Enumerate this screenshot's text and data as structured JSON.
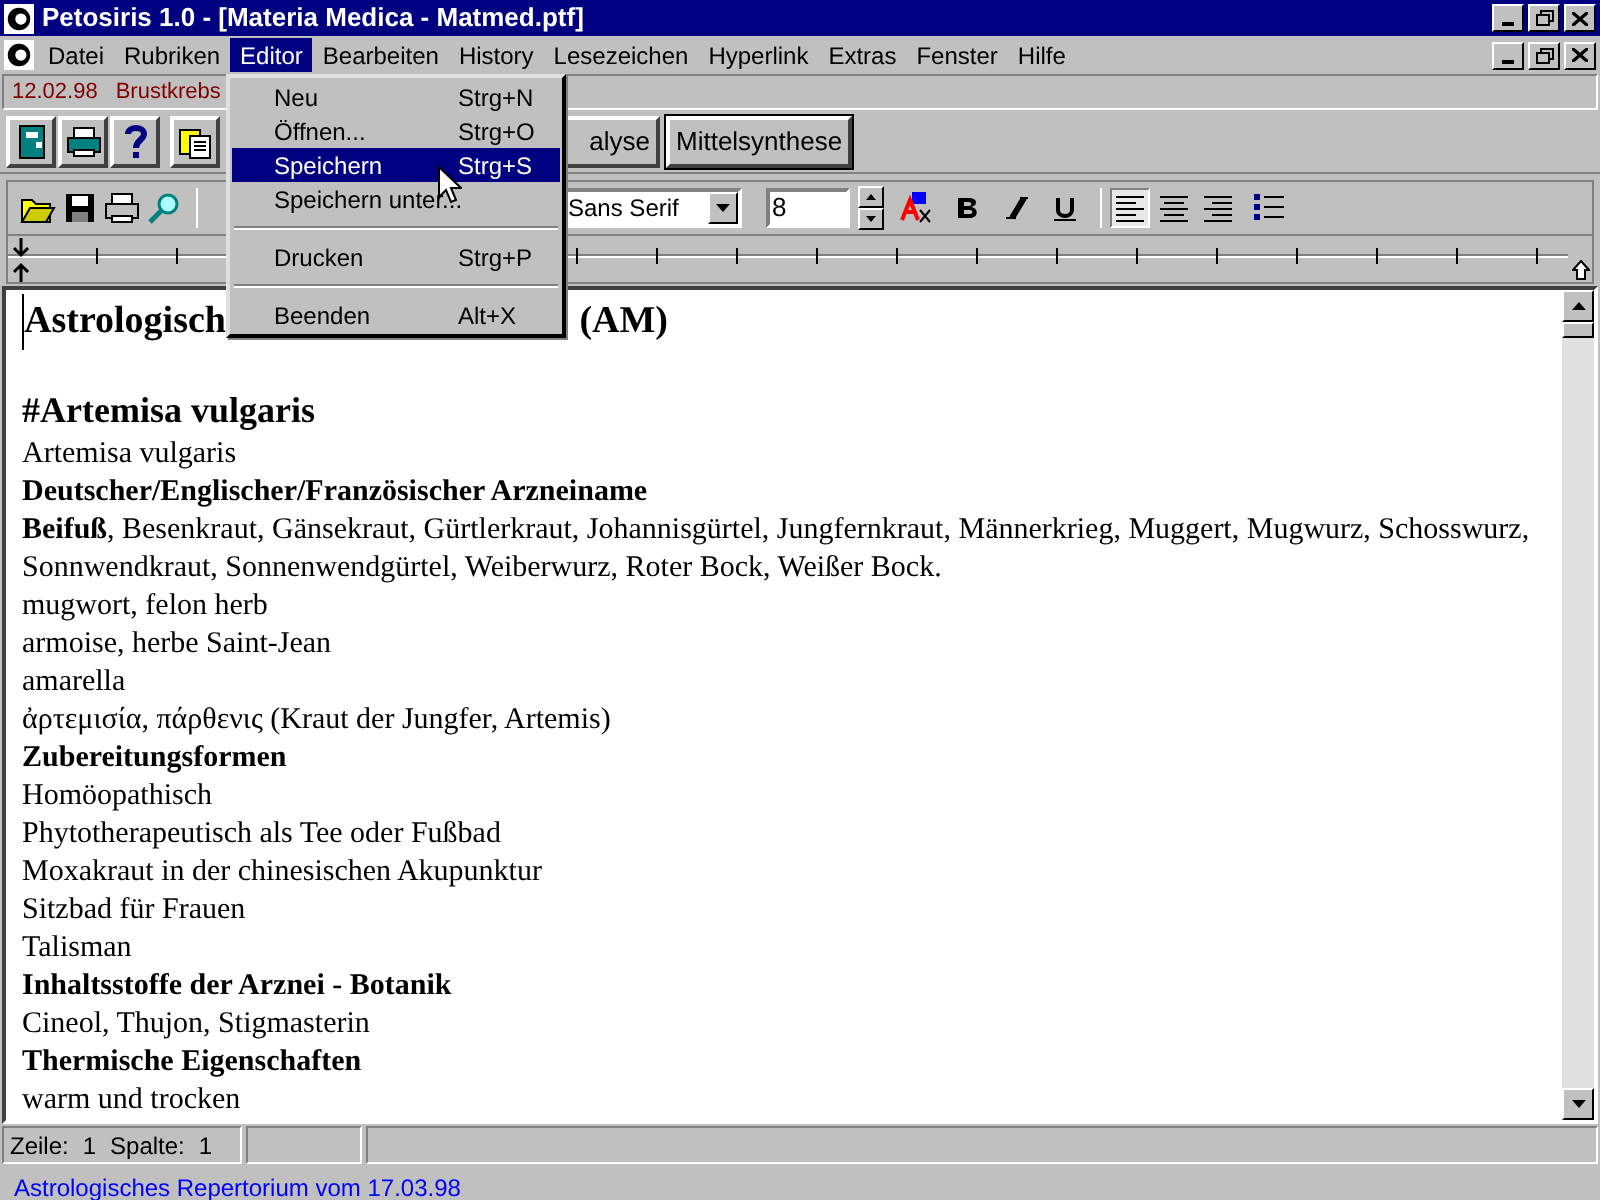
{
  "window": {
    "title": "Petosiris 1.0 - [Materia Medica - Matmed.ptf]"
  },
  "menubar": [
    {
      "label": "Datei",
      "open": false
    },
    {
      "label": "Rubriken",
      "open": false
    },
    {
      "label": "Editor",
      "open": true
    },
    {
      "label": "Bearbeiten",
      "open": false
    },
    {
      "label": "History",
      "open": false
    },
    {
      "label": "Lesezeichen",
      "open": false
    },
    {
      "label": "Hyperlink",
      "open": false
    },
    {
      "label": "Extras",
      "open": false
    },
    {
      "label": "Fenster",
      "open": false
    },
    {
      "label": "Hilfe",
      "open": false
    }
  ],
  "info_bar": {
    "date": "12.02.98",
    "topic": "Brustkrebs"
  },
  "toolbar": {
    "text_buttons": [
      "alyse",
      "Mittelsynthese"
    ]
  },
  "format_bar": {
    "font": "Sans Serif",
    "size": "8",
    "alignment": [
      {
        "kind": "left",
        "selected": true
      },
      {
        "kind": "center",
        "selected": false
      },
      {
        "kind": "right",
        "selected": false
      }
    ]
  },
  "document": {
    "title_start": "Astrologisch",
    "title_end": "(AM)",
    "lines": [
      {
        "kind": "blank"
      },
      {
        "kind": "heading",
        "text": "#Artemisa vulgaris"
      },
      {
        "kind": "normal",
        "text": "Artemisa vulgaris"
      },
      {
        "kind": "bold",
        "text": "Deutscher/Englischer/Französischer Arzneiname"
      },
      {
        "kind": "normal",
        "text": "**Beifuß**, Besenkraut, Gänsekraut, Gürtlerkraut, Johannisgürtel, Jungfernkraut, Männerkrieg, Muggert, Mugwurz, Schosswurz, Sonnwendkraut, Sonnenwendgürtel, Weiberwurz, Roter Bock, Weißer Bock."
      },
      {
        "kind": "normal",
        "text": "mugwort, felon herb"
      },
      {
        "kind": "normal",
        "text": "armoise, herbe Saint-Jean"
      },
      {
        "kind": "normal",
        "text": "amarella"
      },
      {
        "kind": "normal",
        "text": "ἀρτεμισία, πάρθενις (Kraut der Jungfer, Artemis)"
      },
      {
        "kind": "bold",
        "text": "Zubereitungsformen"
      },
      {
        "kind": "normal",
        "text": "Homöopathisch"
      },
      {
        "kind": "normal",
        "text": "Phytotherapeutisch als Tee oder Fußbad"
      },
      {
        "kind": "normal",
        "text": "Moxakraut in der chinesischen Akupunktur"
      },
      {
        "kind": "normal",
        "text": "Sitzbad für Frauen"
      },
      {
        "kind": "normal",
        "text": "Talisman"
      },
      {
        "kind": "bold",
        "text": "Inhaltsstoffe der Arznei - Botanik"
      },
      {
        "kind": "normal",
        "text": "Cineol, Thujon, Stigmasterin"
      },
      {
        "kind": "bold",
        "text": "Thermische Eigenschaften"
      },
      {
        "kind": "normal",
        "text": "warm und trocken"
      }
    ]
  },
  "status_bar": {
    "line_label": "Zeile:",
    "line": "1",
    "column_label": "Spalte:",
    "column": "1"
  },
  "footer": "Astrologisches Repertorium vom 17.03.98",
  "editor_menu": [
    {
      "kind": "item",
      "label": "Neu",
      "shortcut": "Strg+N",
      "selected": false
    },
    {
      "kind": "item",
      "label": "Öffnen...",
      "shortcut": "Strg+O",
      "selected": false
    },
    {
      "kind": "item",
      "label": "Speichern",
      "shortcut": "Strg+S",
      "selected": true
    },
    {
      "kind": "item",
      "label": "Speichern unter...",
      "selected": false
    },
    {
      "kind": "separator"
    },
    {
      "kind": "item",
      "label": "Drucken",
      "shortcut": "Strg+P",
      "selected": false
    },
    {
      "kind": "separator"
    },
    {
      "kind": "item",
      "label": "Beenden",
      "shortcut": "Alt+X",
      "selected": false
    }
  ]
}
